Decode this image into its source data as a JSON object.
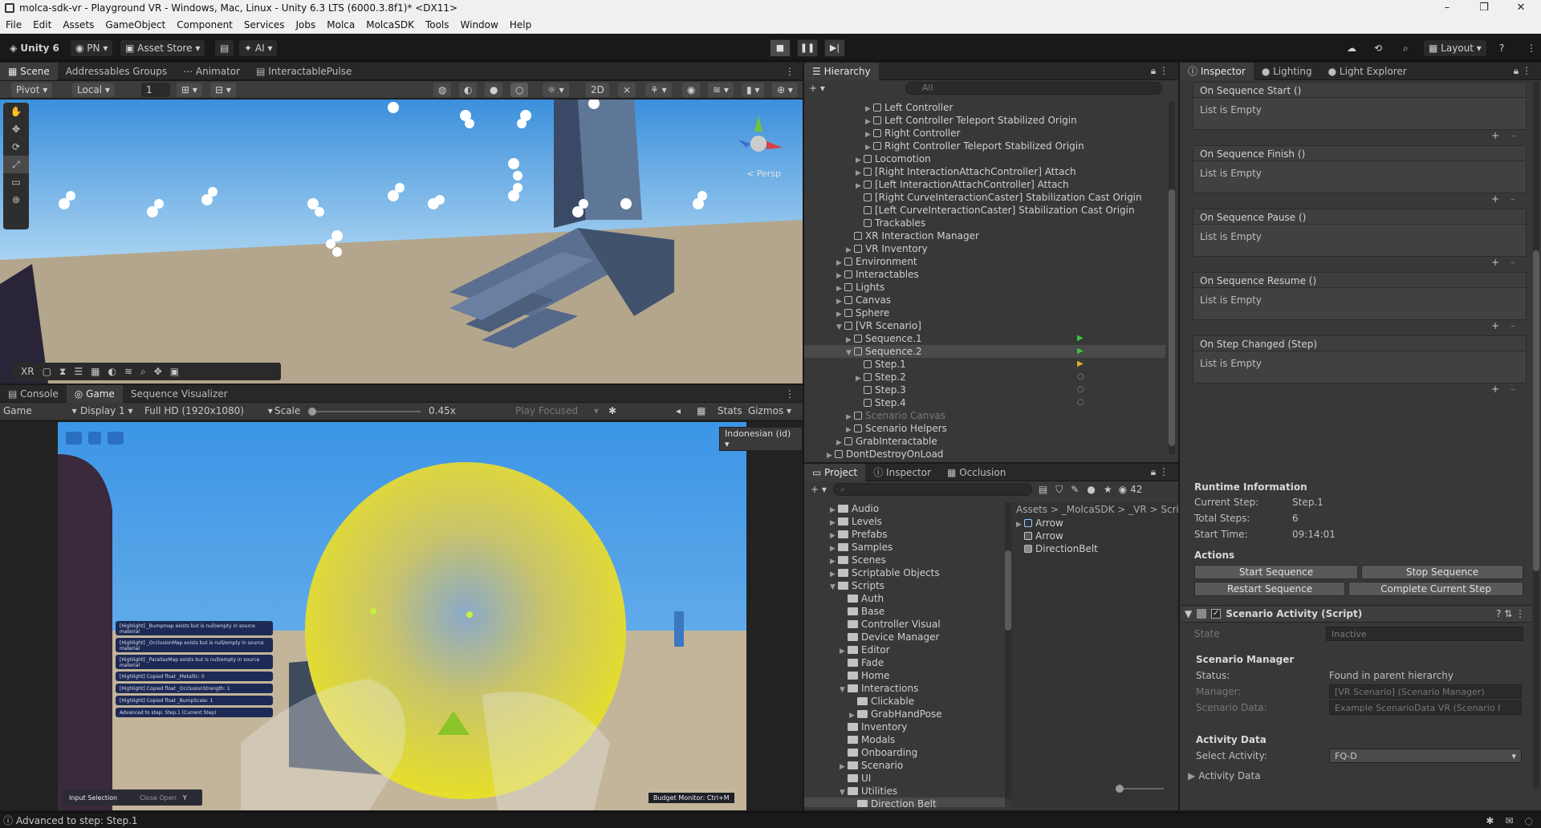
{
  "window": {
    "title": "molca-sdk-vr - Playground VR - Windows, Mac, Linux - Unity 6.3 LTS (6000.3.8f1)* <DX11>",
    "minimize": "–",
    "maximize": "❐",
    "close": "✕"
  },
  "menu": [
    "File",
    "Edit",
    "Assets",
    "GameObject",
    "Component",
    "Services",
    "Jobs",
    "Molca",
    "MolcaSDK",
    "Tools",
    "Window",
    "Help"
  ],
  "toolbar": {
    "unity_label": "Unity 6",
    "account": "PN",
    "asset_store": "Asset Store",
    "ai": "AI",
    "layout": "Layout"
  },
  "scene": {
    "tabs": [
      "Scene",
      "Addressables Groups",
      "Animator",
      "InteractablePulse"
    ],
    "pivot": "Pivot",
    "local": "Local",
    "grid_value": "1",
    "mode_2d": "2D",
    "persp": "< Persp",
    "overlay_xr": "XR"
  },
  "game": {
    "tabs": [
      "Console",
      "Game",
      "Sequence Visualizer"
    ],
    "view": "Game",
    "display": "Display 1",
    "resolution": "Full HD (1920x1080)",
    "scale_label": "Scale",
    "scale_value": "0.45x",
    "play_focused": "Play Focused",
    "stats": "Stats",
    "gizmos": "Gizmos",
    "language": "Indonesian (id)",
    "input_selection": "Input Selection",
    "close_open": "Close  Open",
    "budget_monitor": "Budget Monitor: Ctrl+M",
    "log_lines": [
      "[Highlight] _Bumpmap exists but is null/empty in source material",
      "[Highlight] _OcclusionMap exists but is null/empty in source material",
      "[Highlight] _ParallaxMap exists but is null/empty in source material",
      "[Highlight] Copied float _Metallic: 0",
      "[Highlight] Copied float _OcclusionStrength: 1",
      "[Highlight] Copied float _BumpScale: 1",
      "Advanced to step: Step.1 (Current Step)"
    ]
  },
  "hierarchy": {
    "tab": "Hierarchy",
    "search_placeholder": "All",
    "items": [
      {
        "label": "Left Controller",
        "indent": 6,
        "arrow": "▶"
      },
      {
        "label": "Left Controller Teleport Stabilized Origin",
        "indent": 6,
        "arrow": "▶"
      },
      {
        "label": "Right Controller",
        "indent": 6,
        "arrow": "▶"
      },
      {
        "label": "Right Controller Teleport Stabilized Origin",
        "indent": 6,
        "arrow": "▶"
      },
      {
        "label": "Locomotion",
        "indent": 5,
        "arrow": "▶"
      },
      {
        "label": "[Right InteractionAttachController] Attach",
        "indent": 5,
        "arrow": "▶"
      },
      {
        "label": "[Left InteractionAttachController] Attach",
        "indent": 5,
        "arrow": "▶"
      },
      {
        "label": "[Right CurveInteractionCaster] Stabilization Cast Origin",
        "indent": 5,
        "arrow": ""
      },
      {
        "label": "[Left CurveInteractionCaster] Stabilization Cast Origin",
        "indent": 5,
        "arrow": ""
      },
      {
        "label": "Trackables",
        "indent": 5,
        "arrow": ""
      },
      {
        "label": "XR Interaction Manager",
        "indent": 4,
        "arrow": ""
      },
      {
        "label": "VR Inventory",
        "indent": 4,
        "arrow": "▶"
      },
      {
        "label": "Environment",
        "indent": 3,
        "arrow": "▶"
      },
      {
        "label": "Interactables",
        "indent": 3,
        "arrow": "▶"
      },
      {
        "label": "Lights",
        "indent": 3,
        "arrow": "▶"
      },
      {
        "label": "Canvas",
        "indent": 3,
        "arrow": "▶"
      },
      {
        "label": "Sphere",
        "indent": 3,
        "arrow": "▶"
      },
      {
        "label": "[VR Scenario]",
        "indent": 3,
        "arrow": "▼"
      },
      {
        "label": "Sequence.1",
        "indent": 4,
        "arrow": "▶",
        "marker": "play-green"
      },
      {
        "label": "Sequence.2",
        "indent": 4,
        "arrow": "▼",
        "marker": "play-green",
        "selected": true
      },
      {
        "label": "Step.1",
        "indent": 5,
        "arrow": "",
        "marker": "play-yellow"
      },
      {
        "label": "Step.2",
        "indent": 5,
        "arrow": "▶",
        "marker": "circle"
      },
      {
        "label": "Step.3",
        "indent": 5,
        "arrow": "",
        "marker": "circle"
      },
      {
        "label": "Step.4",
        "indent": 5,
        "arrow": "",
        "marker": "circle"
      },
      {
        "label": "Scenario Canvas",
        "indent": 4,
        "arrow": "▶",
        "dim": true
      },
      {
        "label": "Scenario Helpers",
        "indent": 4,
        "arrow": "▶"
      },
      {
        "label": "GrabInteractable",
        "indent": 3,
        "arrow": "▶"
      },
      {
        "label": "DontDestroyOnLoad",
        "indent": 2,
        "arrow": "▶",
        "unity": true
      }
    ]
  },
  "project": {
    "tabs": [
      "Project",
      "Inspector",
      "Occlusion"
    ],
    "count": "42",
    "breadcrumb": [
      "Assets",
      "_MolcaSDK",
      "_VR",
      "Scrip"
    ],
    "folders": [
      {
        "label": "Audio",
        "indent": 1,
        "arrow": "▶"
      },
      {
        "label": "Levels",
        "indent": 1,
        "arrow": "▶"
      },
      {
        "label": "Prefabs",
        "indent": 1,
        "arrow": "▶"
      },
      {
        "label": "Samples",
        "indent": 1,
        "arrow": "▶"
      },
      {
        "label": "Scenes",
        "indent": 1,
        "arrow": "▶"
      },
      {
        "label": "Scriptable Objects",
        "indent": 1,
        "arrow": "▶"
      },
      {
        "label": "Scripts",
        "indent": 1,
        "arrow": "▼"
      },
      {
        "label": "Auth",
        "indent": 2,
        "arrow": ""
      },
      {
        "label": "Base",
        "indent": 2,
        "arrow": ""
      },
      {
        "label": "Controller Visual",
        "indent": 2,
        "arrow": ""
      },
      {
        "label": "Device Manager",
        "indent": 2,
        "arrow": ""
      },
      {
        "label": "Editor",
        "indent": 2,
        "arrow": "▶"
      },
      {
        "label": "Fade",
        "indent": 2,
        "arrow": ""
      },
      {
        "label": "Home",
        "indent": 2,
        "arrow": ""
      },
      {
        "label": "Interactions",
        "indent": 2,
        "arrow": "▼"
      },
      {
        "label": "Clickable",
        "indent": 3,
        "arrow": ""
      },
      {
        "label": "GrabHandPose",
        "indent": 3,
        "arrow": "▶"
      },
      {
        "label": "Inventory",
        "indent": 2,
        "arrow": ""
      },
      {
        "label": "Modals",
        "indent": 2,
        "arrow": ""
      },
      {
        "label": "Onboarding",
        "indent": 2,
        "arrow": ""
      },
      {
        "label": "Scenario",
        "indent": 2,
        "arrow": "▶"
      },
      {
        "label": "UI",
        "indent": 2,
        "arrow": ""
      },
      {
        "label": "Utilities",
        "indent": 2,
        "arrow": "▼"
      },
      {
        "label": "Direction Belt",
        "indent": 3,
        "arrow": "",
        "selected": true
      }
    ],
    "assets": [
      "Arrow",
      "Arrow",
      "DirectionBelt"
    ]
  },
  "inspector": {
    "tabs": [
      "Inspector",
      "Lighting",
      "Light Explorer"
    ],
    "events": [
      {
        "header": "On Sequence Start ()",
        "body": "List is Empty"
      },
      {
        "header": "On Sequence Finish ()",
        "body": "List is Empty"
      },
      {
        "header": "On Sequence Pause ()",
        "body": "List is Empty"
      },
      {
        "header": "On Sequence Resume ()",
        "body": "List is Empty"
      },
      {
        "header": "On Step Changed (Step)",
        "body": "List is Empty"
      }
    ],
    "runtime": {
      "title": "Runtime Information",
      "rows": [
        {
          "label": "Current Step:",
          "value": "Step.1"
        },
        {
          "label": "Total Steps:",
          "value": "6"
        },
        {
          "label": "Start Time:",
          "value": "09:14:01"
        }
      ]
    },
    "actions": {
      "title": "Actions",
      "start": "Start Sequence",
      "stop": "Stop Sequence",
      "restart": "Restart Sequence",
      "complete": "Complete Current Step"
    },
    "component": {
      "title": "Scenario Activity (Script)",
      "state_label": "State",
      "state_value": "Inactive",
      "manager_title": "Scenario Manager",
      "status_label": "Status:",
      "status_value": "Found in parent hierarchy",
      "manager_label": "Manager:",
      "manager_value": "[VR Scenario] (Scenario Manager)",
      "data_label": "Scenario Data:",
      "data_value": "Example ScenarioData VR (Scenario I",
      "activity_title": "Activity Data",
      "select_label": "Select Activity:",
      "select_value": "FQ-D",
      "foldout": "Activity Data"
    }
  },
  "status": {
    "message": "Advanced to step: Step.1"
  },
  "colors": {
    "sky": "#4da3ea",
    "ground": "#b2a58d",
    "sphere": "#e6df3a",
    "play_green": "#3cc43c",
    "play_yellow": "#e0b020"
  }
}
